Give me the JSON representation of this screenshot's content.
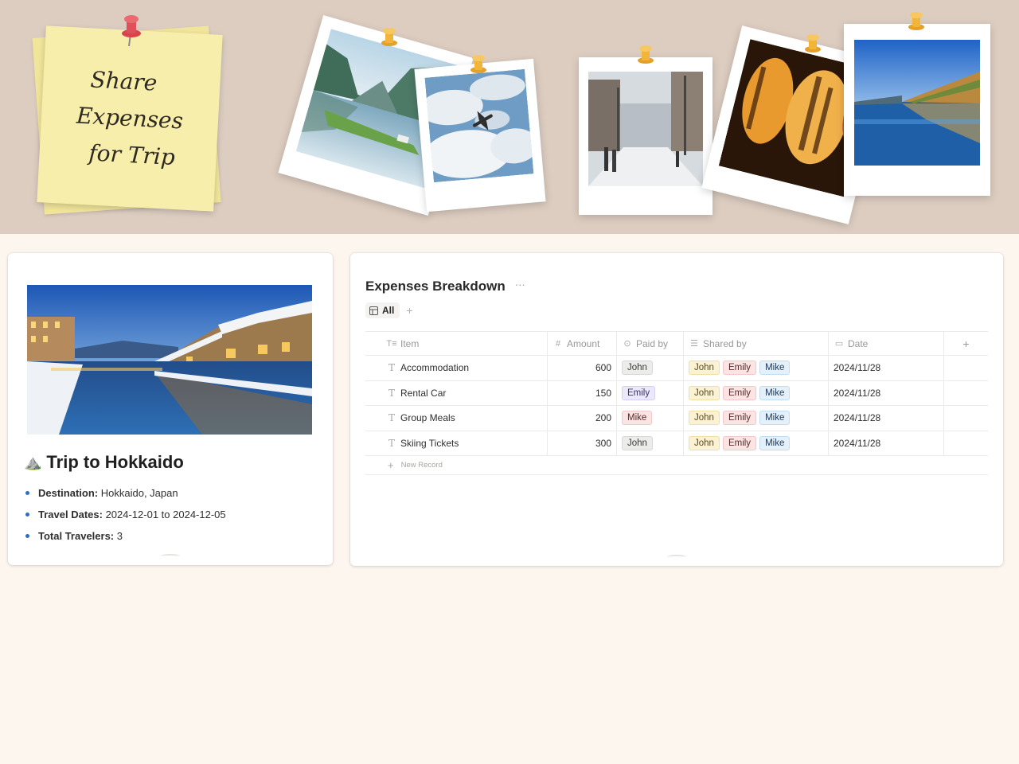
{
  "banner": {
    "sticky_lines": [
      "Share",
      "Expenses",
      "for Trip"
    ],
    "photos": [
      "fjord-photo",
      "airplane-sky-photo",
      "snowy-street-photo",
      "lanterns-photo",
      "canal-evening-photo"
    ]
  },
  "trip": {
    "emoji": "⛰️",
    "title": "Trip to Hokkaido",
    "details": [
      {
        "label": "Destination:",
        "value": "Hokkaido, Japan"
      },
      {
        "label": "Travel Dates:",
        "value": "2024-12-01 to 2024-12-05"
      },
      {
        "label": "Total Travelers:",
        "value": "3"
      }
    ]
  },
  "expenses": {
    "title": "Expenses Breakdown",
    "more": "···",
    "view_tab": "All",
    "add_view": "+",
    "columns": {
      "item": "Item",
      "amount": "Amount",
      "paid_by": "Paid by",
      "shared_by": "Shared by",
      "date": "Date",
      "add": "+"
    },
    "rows": [
      {
        "item": "Accommodation",
        "amount": "600",
        "paid_by": "John",
        "shared": [
          "John",
          "Emily",
          "Mike"
        ],
        "date": "2024/11/28"
      },
      {
        "item": "Rental Car",
        "amount": "150",
        "paid_by": "Emily",
        "shared": [
          "John",
          "Emily",
          "Mike"
        ],
        "date": "2024/11/28"
      },
      {
        "item": "Group Meals",
        "amount": "200",
        "paid_by": "Mike",
        "shared": [
          "John",
          "Emily",
          "Mike"
        ],
        "date": "2024/11/28"
      },
      {
        "item": "Skiing Tickets",
        "amount": "300",
        "paid_by": "John",
        "shared": [
          "John",
          "Emily",
          "Mike"
        ],
        "date": "2024/11/28"
      }
    ],
    "new_record": "New Record"
  },
  "colors": {
    "banner_bg": "#ddcdc1",
    "page_bg": "#fdf6ef",
    "sticky_note": "#f8eeab",
    "pin_red": "#e0505a",
    "pin_yellow": "#f2b53a",
    "bullet_blue": "#2c6fbf"
  }
}
